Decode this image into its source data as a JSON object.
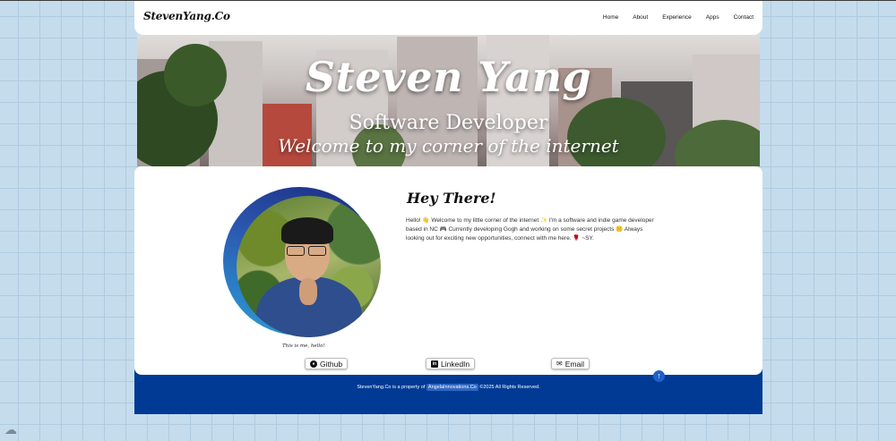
{
  "header": {
    "brand": "StevenYang.Co",
    "nav": [
      "Home",
      "About",
      "Experience",
      "Apps",
      "Contact"
    ]
  },
  "hero": {
    "title": "Steven Yang",
    "subtitle": "Software Developer",
    "tagline": "Welcome to my corner of the internet"
  },
  "about": {
    "heading": "Hey There!",
    "intro": "Hello! 👋 Welcome to my little corner of the internet ✨ I'm a software and indie game developer based in NC 🎮 Currently developing Gogh and working on some secret projects 🤫 Always looking out for exciting new opportunities, connect with me here. 🌹 ~SY.",
    "photo_caption": "This is me, hello!"
  },
  "links": {
    "github": "Github",
    "linkedin": "LinkedIn",
    "email": "Email"
  },
  "footer": {
    "prefix": "StevenYang.Co is a property of",
    "company": "AngelaInnovations.Co",
    "suffix": "©2025 All Rights Reserved."
  },
  "icons": {
    "github": "github-icon",
    "linkedin": "linkedin-icon",
    "email": "envelope-icon",
    "scroll_top": "arrow-up-icon",
    "cloud": "cloud-icon"
  },
  "colors": {
    "footer_bg": "#003a94",
    "accent": "#1f5fc8",
    "page_bg": "#c5dcec"
  }
}
